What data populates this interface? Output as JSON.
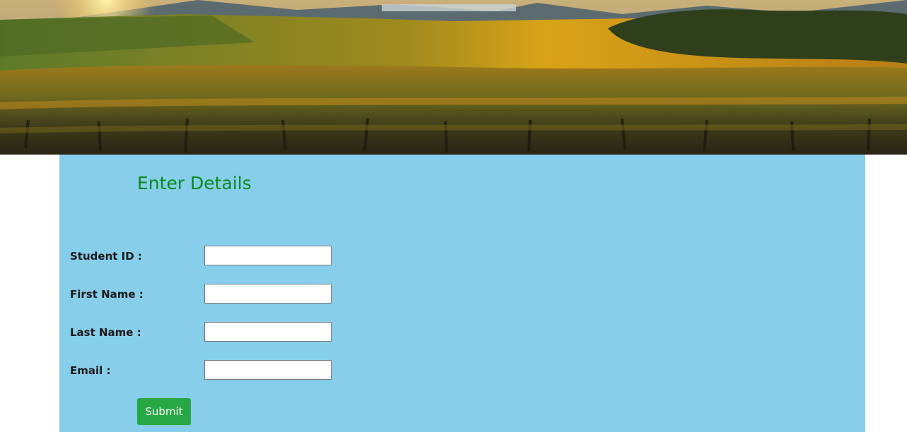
{
  "colors": {
    "panel_background": "#87ceeb",
    "title_color": "#0a8a1f",
    "submit_background": "#28a745",
    "submit_text": "#ffffff"
  },
  "hero": {
    "image": "vineyard-landscape-at-sunset"
  },
  "form": {
    "title": "Enter Details",
    "fields": [
      {
        "label": "Student ID :",
        "value": ""
      },
      {
        "label": "First Name :",
        "value": ""
      },
      {
        "label": "Last Name :",
        "value": ""
      },
      {
        "label": "Email :",
        "value": ""
      }
    ],
    "submit_label": "Submit"
  }
}
